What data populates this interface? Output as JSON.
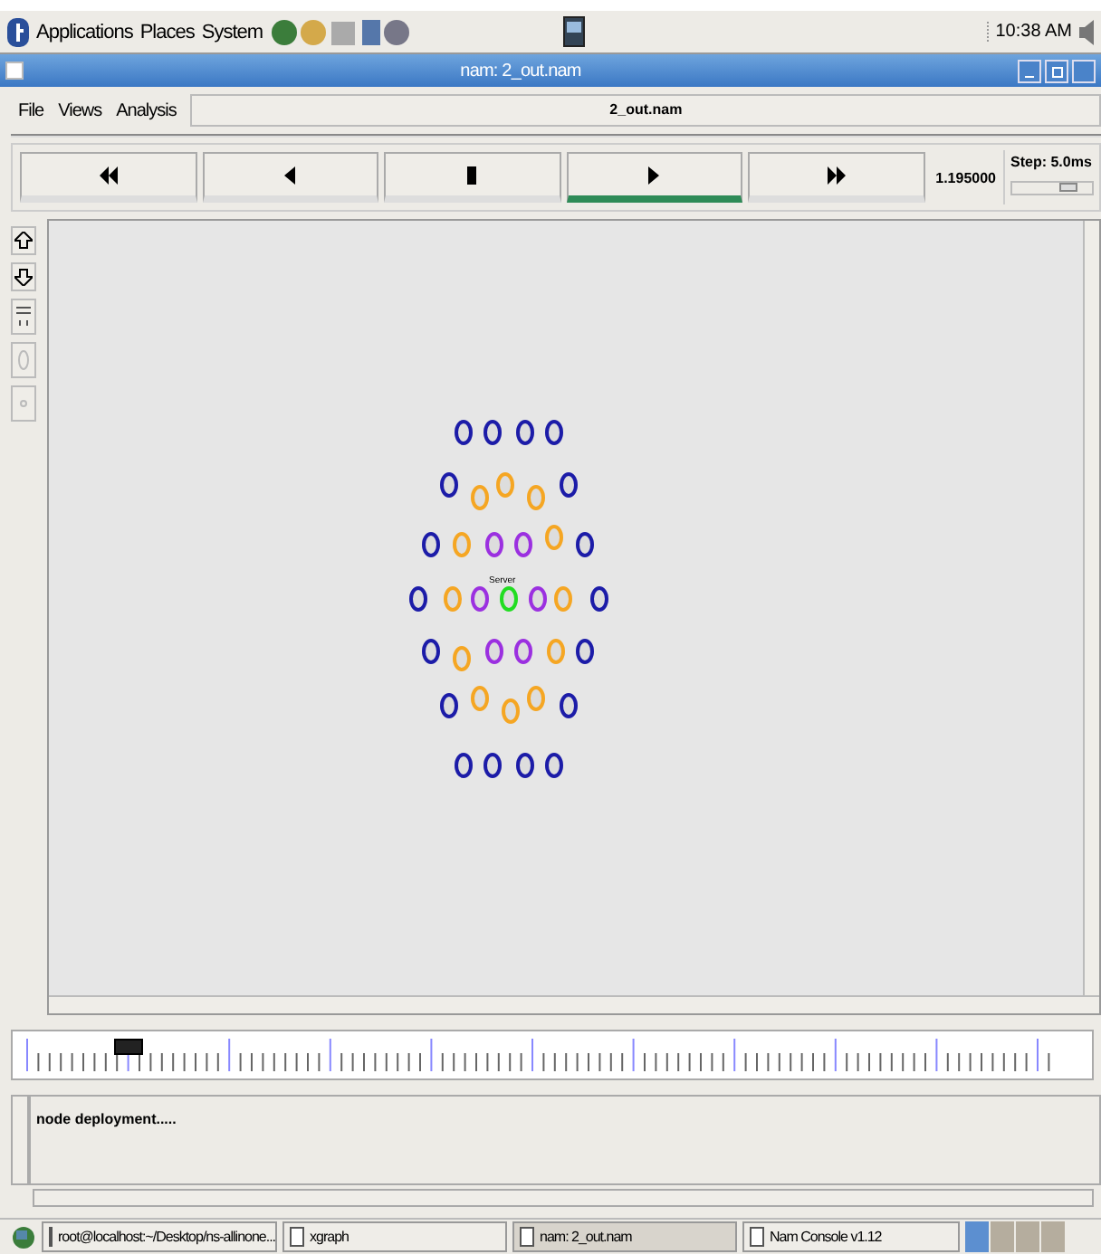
{
  "top_panel": {
    "menus": [
      "Applications",
      "Places",
      "System"
    ],
    "clock": "10:38 AM"
  },
  "window": {
    "title": "nam: 2_out.nam"
  },
  "menu": [
    "File",
    "Views",
    "Analysis"
  ],
  "file_label": "2_out.nam",
  "controls": [
    {
      "kind": "rewind",
      "selected": false
    },
    {
      "kind": "back",
      "selected": false
    },
    {
      "kind": "stop",
      "selected": false
    },
    {
      "kind": "play",
      "selected": true
    },
    {
      "kind": "forward",
      "selected": false
    }
  ],
  "time": "1.195000",
  "step": "Step: 5.0ms",
  "step_slider": {
    "level": 0.7
  },
  "nodes": [
    {
      "color": "#1c1ca8"
    },
    {
      "color": "#1c1ca8"
    },
    {
      "color": "#1c1ca8"
    },
    {
      "color": "#1c1ca8"
    },
    {
      "color": "#1c1ca8"
    },
    {
      "color": "#f5a623"
    },
    {
      "color": "#f5a623"
    },
    {
      "color": "#f5a623"
    },
    {
      "color": "#1c1ca8"
    },
    {
      "color": "#1c1ca8"
    },
    {
      "color": "#f5a623"
    },
    {
      "color": "#9b30e0"
    },
    {
      "color": "#9b30e0"
    },
    {
      "color": "#f5a623"
    },
    {
      "color": "#1c1ca8"
    },
    {
      "color": "#1c1ca8"
    },
    {
      "color": "#f5a623"
    },
    {
      "color": "#9b30e0"
    },
    {
      "color": "#22dd22",
      "label": "Server"
    },
    {
      "color": "#9b30e0"
    },
    {
      "color": "#f5a623"
    },
    {
      "color": "#1c1ca8"
    },
    {
      "color": "#1c1ca8"
    },
    {
      "color": "#f5a623"
    },
    {
      "color": "#9b30e0"
    },
    {
      "color": "#9b30e0"
    },
    {
      "color": "#f5a623"
    },
    {
      "color": "#1c1ca8"
    },
    {
      "color": "#1c1ca8"
    },
    {
      "color": "#f5a623"
    },
    {
      "color": "#f5a623"
    },
    {
      "color": "#f5a623"
    },
    {
      "color": "#1c1ca8"
    },
    {
      "color": "#1c1ca8"
    },
    {
      "color": "#1c1ca8"
    },
    {
      "color": "#1c1ca8"
    },
    {
      "color": "#1c1ca8"
    }
  ],
  "log": "node deployment.....",
  "taskbar": [
    {
      "label": "root@localhost:~/Desktop/ns-allinone...",
      "selected": false
    },
    {
      "label": "xgraph",
      "selected": false
    },
    {
      "label": "nam: 2_out.nam",
      "selected": true
    },
    {
      "label": "Nam Console v1.12",
      "selected": false
    }
  ]
}
